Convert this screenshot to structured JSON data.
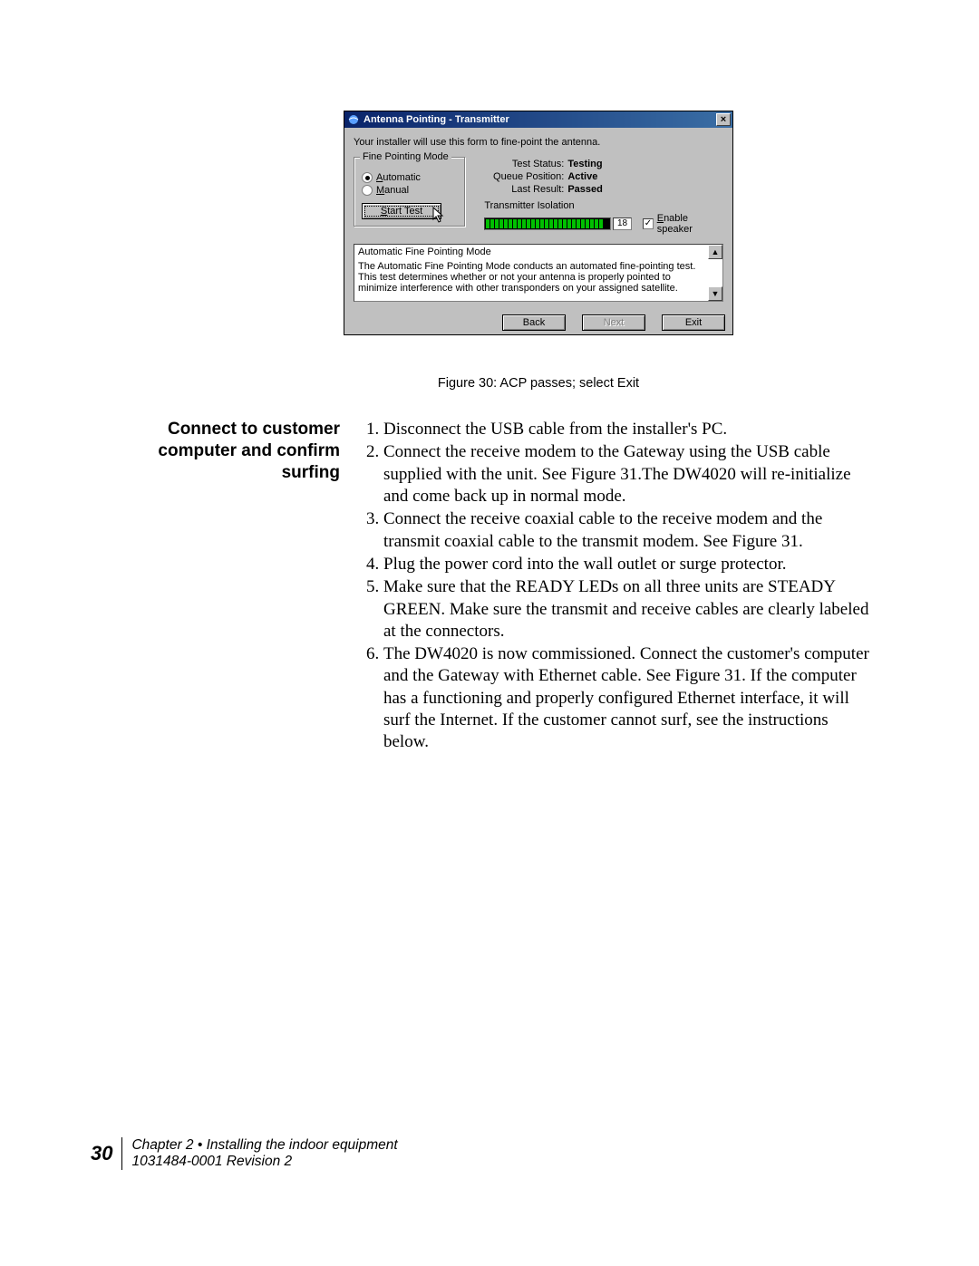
{
  "dialog": {
    "title": "Antenna Pointing - Transmitter",
    "close_glyph": "×",
    "intro": "Your installer will use this form to fine-point the antenna.",
    "group_legend": "Fine Pointing Mode",
    "radio_auto": "Automatic",
    "radio_manual": "Manual",
    "start_test": "Start Test",
    "status": {
      "test_status_label": "Test Status:",
      "test_status_val": "Testing",
      "queue_label": "Queue Position:",
      "queue_val": "Active",
      "last_result_label": "Last Result:",
      "last_result_val": "Passed"
    },
    "iso_label": "Transmitter Isolation",
    "iso_value": "18",
    "enable_speaker": "Enable speaker",
    "check_glyph": "✓",
    "info_title": "Automatic Fine Pointing Mode",
    "info_text": "The Automatic Fine Pointing Mode conducts an automated fine-pointing test. This test determines whether or not your antenna is properly pointed to minimize interference with other transponders on your assigned satellite.",
    "sb_up": "▲",
    "sb_down": "▼",
    "back": "Back",
    "next": "Next",
    "exit": "Exit"
  },
  "caption": "Figure 30:  ACP passes; select Exit",
  "heading": "Connect to customer computer and confirm surfing",
  "steps": [
    "Disconnect the USB cable from the installer's PC.",
    "Connect the receive modem to the Gateway using the USB cable supplied with the unit. See Figure 31.The DW4020 will re-initialize and come back up in normal mode.",
    "Connect the receive coaxial cable to the receive modem and the transmit coaxial cable to the transmit modem. See Figure 31.",
    "Plug the power cord into the wall outlet or surge protector.",
    "Make sure that the READY LEDs on all three units are STEADY GREEN. Make sure the transmit and receive cables are clearly labeled at the connectors.",
    "The DW4020 is now commissioned. Connect the customer's computer and the Gateway with Ethernet cable. See Figure 31. If the computer has a functioning and properly configured Ethernet interface, it will surf the Internet. If the customer cannot surf, see the instructions below."
  ],
  "footer": {
    "page": "30",
    "line1": "Chapter 2 • Installing the indoor equipment",
    "line2": "1031484-0001  Revision 2"
  }
}
